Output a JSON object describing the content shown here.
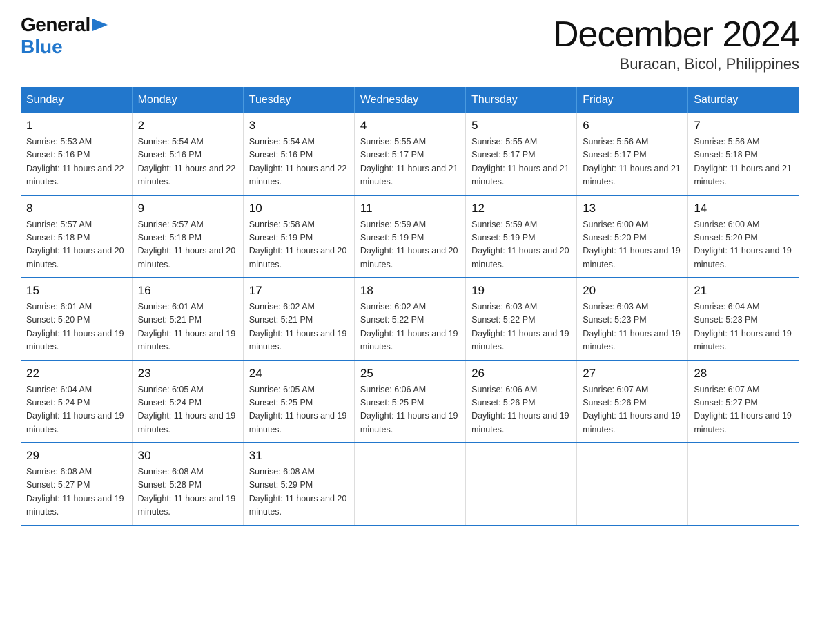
{
  "header": {
    "logo_general": "General",
    "logo_blue": "Blue",
    "month_year": "December 2024",
    "location": "Buracan, Bicol, Philippines"
  },
  "days_of_week": [
    "Sunday",
    "Monday",
    "Tuesday",
    "Wednesday",
    "Thursday",
    "Friday",
    "Saturday"
  ],
  "weeks": [
    [
      {
        "day": "1",
        "sunrise": "5:53 AM",
        "sunset": "5:16 PM",
        "daylight": "11 hours and 22 minutes."
      },
      {
        "day": "2",
        "sunrise": "5:54 AM",
        "sunset": "5:16 PM",
        "daylight": "11 hours and 22 minutes."
      },
      {
        "day": "3",
        "sunrise": "5:54 AM",
        "sunset": "5:16 PM",
        "daylight": "11 hours and 22 minutes."
      },
      {
        "day": "4",
        "sunrise": "5:55 AM",
        "sunset": "5:17 PM",
        "daylight": "11 hours and 21 minutes."
      },
      {
        "day": "5",
        "sunrise": "5:55 AM",
        "sunset": "5:17 PM",
        "daylight": "11 hours and 21 minutes."
      },
      {
        "day": "6",
        "sunrise": "5:56 AM",
        "sunset": "5:17 PM",
        "daylight": "11 hours and 21 minutes."
      },
      {
        "day": "7",
        "sunrise": "5:56 AM",
        "sunset": "5:18 PM",
        "daylight": "11 hours and 21 minutes."
      }
    ],
    [
      {
        "day": "8",
        "sunrise": "5:57 AM",
        "sunset": "5:18 PM",
        "daylight": "11 hours and 20 minutes."
      },
      {
        "day": "9",
        "sunrise": "5:57 AM",
        "sunset": "5:18 PM",
        "daylight": "11 hours and 20 minutes."
      },
      {
        "day": "10",
        "sunrise": "5:58 AM",
        "sunset": "5:19 PM",
        "daylight": "11 hours and 20 minutes."
      },
      {
        "day": "11",
        "sunrise": "5:59 AM",
        "sunset": "5:19 PM",
        "daylight": "11 hours and 20 minutes."
      },
      {
        "day": "12",
        "sunrise": "5:59 AM",
        "sunset": "5:19 PM",
        "daylight": "11 hours and 20 minutes."
      },
      {
        "day": "13",
        "sunrise": "6:00 AM",
        "sunset": "5:20 PM",
        "daylight": "11 hours and 19 minutes."
      },
      {
        "day": "14",
        "sunrise": "6:00 AM",
        "sunset": "5:20 PM",
        "daylight": "11 hours and 19 minutes."
      }
    ],
    [
      {
        "day": "15",
        "sunrise": "6:01 AM",
        "sunset": "5:20 PM",
        "daylight": "11 hours and 19 minutes."
      },
      {
        "day": "16",
        "sunrise": "6:01 AM",
        "sunset": "5:21 PM",
        "daylight": "11 hours and 19 minutes."
      },
      {
        "day": "17",
        "sunrise": "6:02 AM",
        "sunset": "5:21 PM",
        "daylight": "11 hours and 19 minutes."
      },
      {
        "day": "18",
        "sunrise": "6:02 AM",
        "sunset": "5:22 PM",
        "daylight": "11 hours and 19 minutes."
      },
      {
        "day": "19",
        "sunrise": "6:03 AM",
        "sunset": "5:22 PM",
        "daylight": "11 hours and 19 minutes."
      },
      {
        "day": "20",
        "sunrise": "6:03 AM",
        "sunset": "5:23 PM",
        "daylight": "11 hours and 19 minutes."
      },
      {
        "day": "21",
        "sunrise": "6:04 AM",
        "sunset": "5:23 PM",
        "daylight": "11 hours and 19 minutes."
      }
    ],
    [
      {
        "day": "22",
        "sunrise": "6:04 AM",
        "sunset": "5:24 PM",
        "daylight": "11 hours and 19 minutes."
      },
      {
        "day": "23",
        "sunrise": "6:05 AM",
        "sunset": "5:24 PM",
        "daylight": "11 hours and 19 minutes."
      },
      {
        "day": "24",
        "sunrise": "6:05 AM",
        "sunset": "5:25 PM",
        "daylight": "11 hours and 19 minutes."
      },
      {
        "day": "25",
        "sunrise": "6:06 AM",
        "sunset": "5:25 PM",
        "daylight": "11 hours and 19 minutes."
      },
      {
        "day": "26",
        "sunrise": "6:06 AM",
        "sunset": "5:26 PM",
        "daylight": "11 hours and 19 minutes."
      },
      {
        "day": "27",
        "sunrise": "6:07 AM",
        "sunset": "5:26 PM",
        "daylight": "11 hours and 19 minutes."
      },
      {
        "day": "28",
        "sunrise": "6:07 AM",
        "sunset": "5:27 PM",
        "daylight": "11 hours and 19 minutes."
      }
    ],
    [
      {
        "day": "29",
        "sunrise": "6:08 AM",
        "sunset": "5:27 PM",
        "daylight": "11 hours and 19 minutes."
      },
      {
        "day": "30",
        "sunrise": "6:08 AM",
        "sunset": "5:28 PM",
        "daylight": "11 hours and 19 minutes."
      },
      {
        "day": "31",
        "sunrise": "6:08 AM",
        "sunset": "5:29 PM",
        "daylight": "11 hours and 20 minutes."
      },
      null,
      null,
      null,
      null
    ]
  ]
}
